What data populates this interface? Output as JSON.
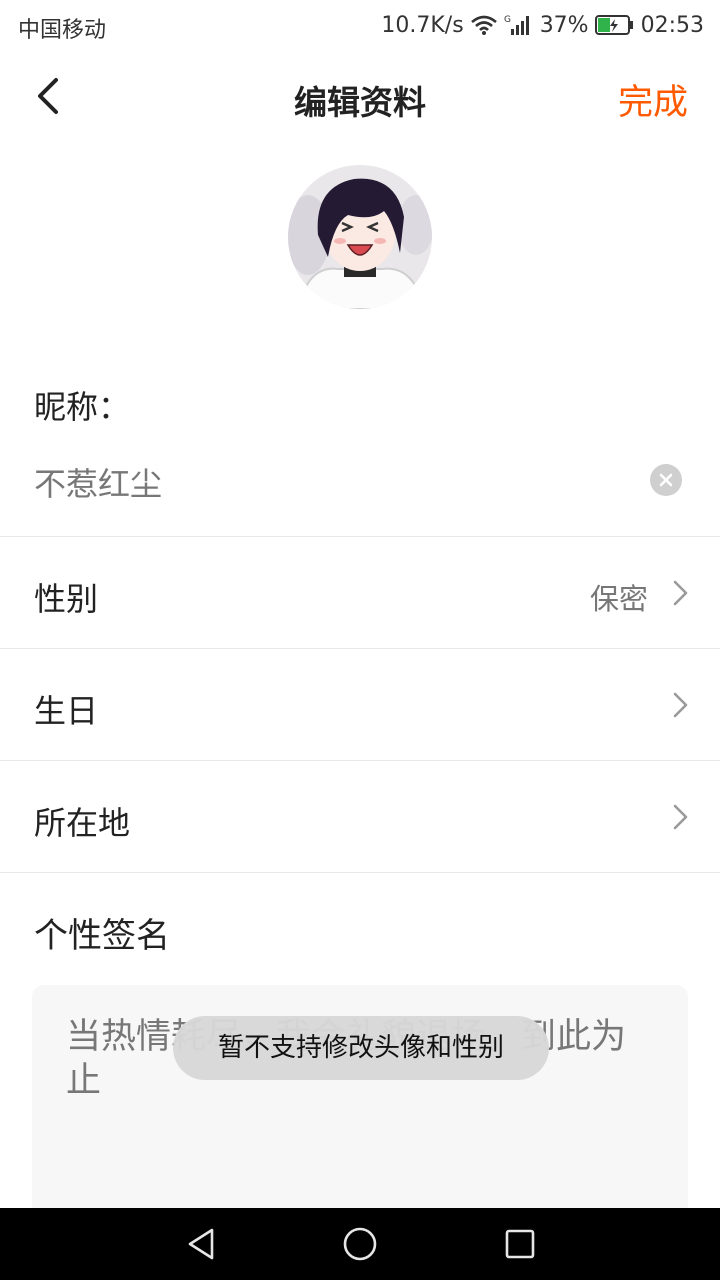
{
  "status_bar": {
    "carrier": "中国移动",
    "net_speed": "10.7K/s",
    "battery_level": "37%",
    "time": "02:53",
    "icons": [
      "wifi-icon",
      "signal-icon",
      "battery-charging-icon"
    ]
  },
  "nav": {
    "title": "编辑资料",
    "done_label": "完成",
    "back_icon": "chevron-left-icon",
    "accent_color": "#ff5a00"
  },
  "profile": {
    "avatar_icon": "avatar-image",
    "nickname_label": "昵称：",
    "nickname_value": "不惹红尘",
    "clear_icon": "clear-icon"
  },
  "rows": [
    {
      "label": "性别",
      "value": "保密"
    },
    {
      "label": "生日",
      "value": ""
    },
    {
      "label": "所在地",
      "value": ""
    }
  ],
  "signature": {
    "label": "个性签名",
    "text": "当热情耗尽，我会礼貌退场，到此为止"
  },
  "toast": {
    "text": "暂不支持修改头像和性别"
  },
  "system_nav": {
    "icons": [
      "back-triangle-icon",
      "home-circle-icon",
      "recents-square-icon"
    ]
  }
}
